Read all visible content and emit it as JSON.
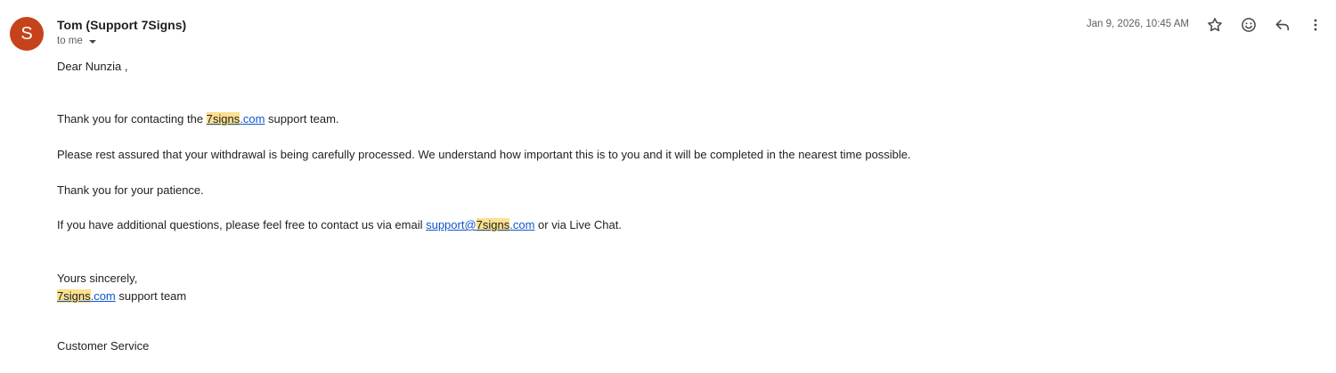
{
  "header": {
    "avatar_letter": "S",
    "avatar_color": "#c5421b",
    "sender_name": "Tom (Support 7Signs)",
    "recipient_label": "to me",
    "date": "Jan 9, 2026, 10:45 AM",
    "icons": [
      "star-icon",
      "emoji-icon",
      "reply-icon",
      "more-vert-icon"
    ]
  },
  "body": {
    "greeting": "Dear Nunzia ,",
    "line1_prefix": "Thank you for contacting the ",
    "line1_link_highlight": "7signs",
    "line1_link_rest": ".com",
    "line1_suffix": " support team.",
    "line2": "Please rest assured that your withdrawal is being carefully processed. We understand how important this is to you and it will be completed in the nearest time possible.",
    "line3": "Thank you for your patience.",
    "line4_prefix": "If you have additional questions, please feel free to contact us via email ",
    "line4_email_start": "support@",
    "line4_email_highlight": "7signs",
    "line4_email_end": ".com",
    "line4_suffix": " or via Live Chat.",
    "closing": "Yours sincerely,",
    "signature_highlight": "7signs",
    "signature_link_rest": ".com",
    "signature_suffix": " support team",
    "footer": "Customer Service"
  },
  "colors": {
    "highlight": "#fbe08f",
    "link": "#1155cc"
  }
}
